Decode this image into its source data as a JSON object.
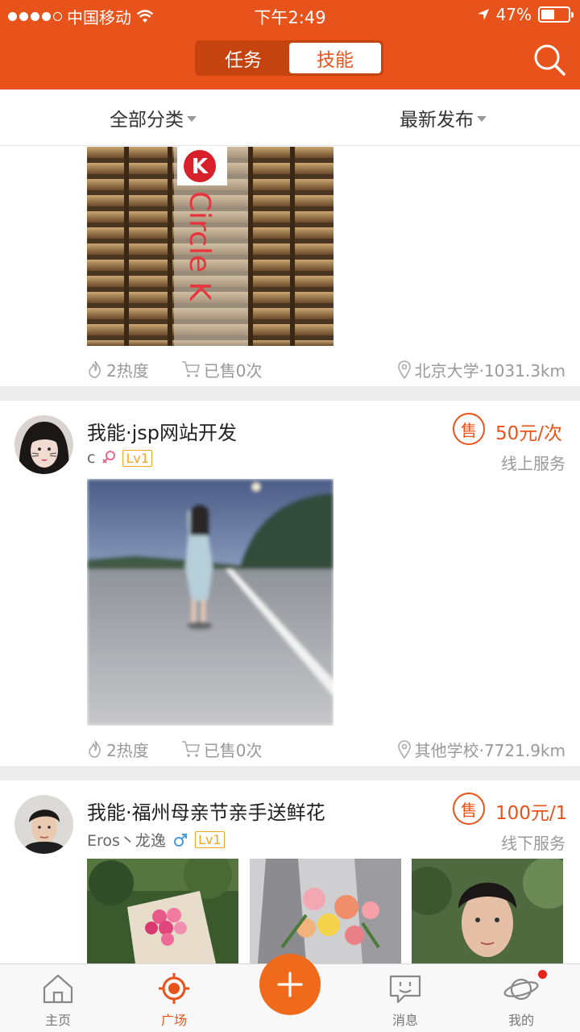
{
  "status_bar": {
    "carrier": "中国移动",
    "time": "下午2:49",
    "battery": "47%"
  },
  "header": {
    "tabs": [
      {
        "label": "任务",
        "active": false
      },
      {
        "label": "技能",
        "active": true
      }
    ],
    "search_icon": "search-icon",
    "accent": "#e8531b"
  },
  "filters": {
    "category": "全部分类",
    "sort": "最新发布"
  },
  "posts": [
    {
      "heat": "2热度",
      "sold": "已售0次",
      "location": "北京大学·1031.3km",
      "photo_text": "Circle K"
    },
    {
      "title": "我能·jsp网站开发",
      "user": "c",
      "gender": "female",
      "level": "Lv1",
      "badge": "售",
      "price": "50元/次",
      "service": "线上服务",
      "heat": "2热度",
      "sold": "已售0次",
      "location": "其他学校·7721.9km"
    },
    {
      "title": "我能·福州母亲节亲手送鲜花",
      "user": "Eros丶龙逸",
      "gender": "male",
      "level": "Lv1",
      "badge": "售",
      "price": "100元/1",
      "service": "线下服务"
    }
  ],
  "tabbar": {
    "items": [
      {
        "label": "主页",
        "icon": "home-icon",
        "active": false
      },
      {
        "label": "广场",
        "icon": "square-icon",
        "active": true
      },
      {
        "label": "消息",
        "icon": "message-icon",
        "active": false
      },
      {
        "label": "我的",
        "icon": "planet-icon",
        "active": false
      }
    ],
    "add_icon": "plus-icon"
  }
}
